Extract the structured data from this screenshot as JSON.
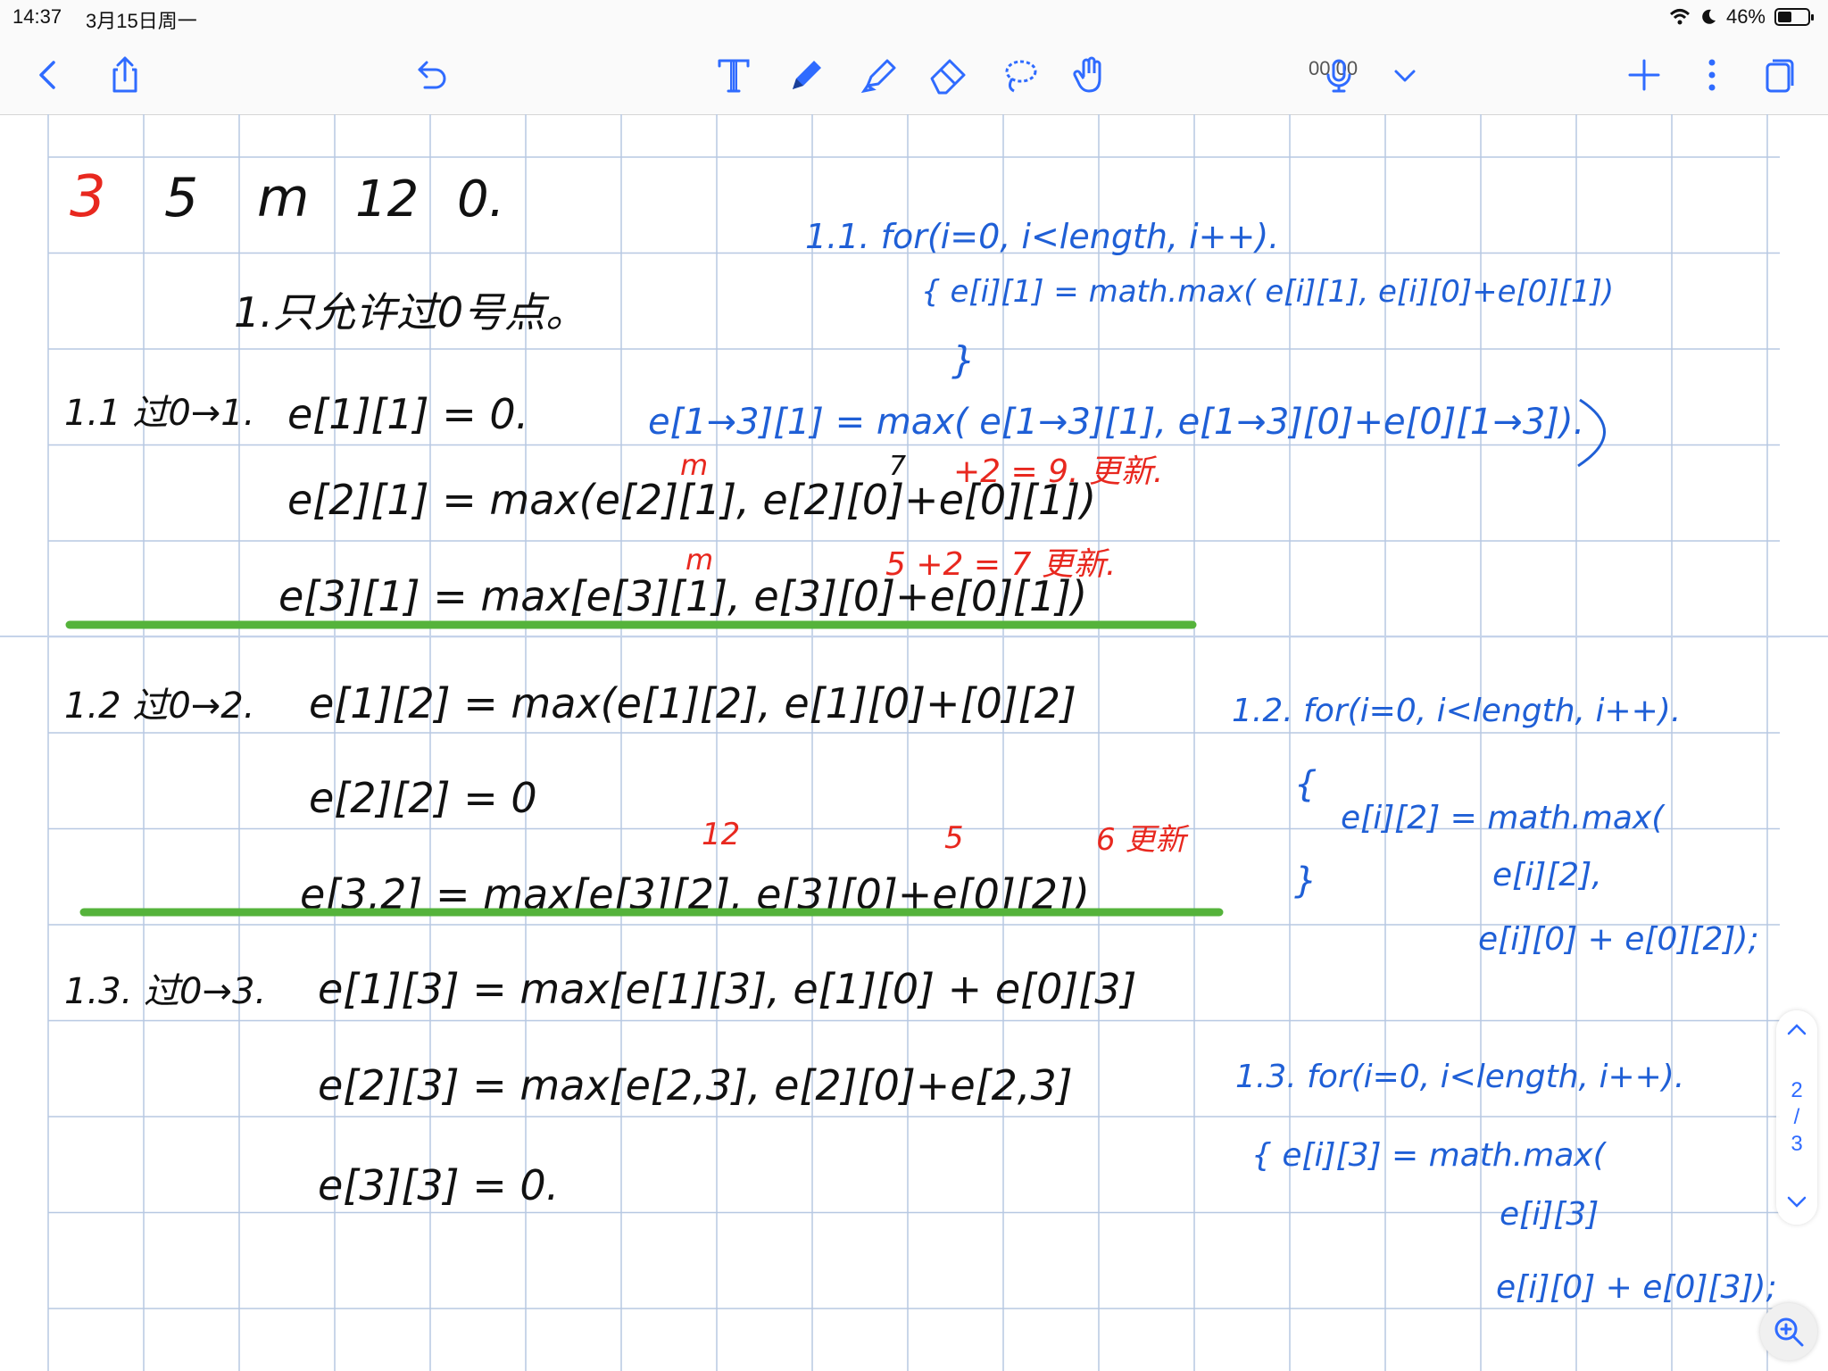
{
  "status_bar": {
    "time": "14:37",
    "date": "3月15日周一",
    "battery": "46%",
    "battery_level": 0.46
  },
  "toolbar": {
    "timer": "00:00"
  },
  "notes": {
    "black": [
      {
        "text": "3",
        "color": "red"
      },
      {
        "text": "5",
        "color": "black"
      },
      {
        "text": "m",
        "color": "black"
      },
      {
        "text": "12",
        "color": "black"
      },
      {
        "text": "0.",
        "color": "black"
      },
      {
        "text": "1.只允许过0号点。",
        "color": "black"
      },
      {
        "text": "1.1 过0→1.",
        "color": "black"
      },
      {
        "text": "e[1][1] = 0.",
        "color": "black"
      },
      {
        "text": "e[2][1] = max(e[2][1], e[2][0]+e[0][1])",
        "color": "black"
      },
      {
        "text": "e[3][1] = max[e[3][1], e[3][0]+e[0][1])",
        "color": "black"
      },
      {
        "text": "1.2 过0→2.",
        "color": "black"
      },
      {
        "text": "e[1][2] = max(e[1][2], e[1][0]+[0][2]",
        "color": "black"
      },
      {
        "text": "e[2][2] = 0",
        "color": "black"
      },
      {
        "text": "e[3,2] = max[e[3][2], e[3][0]+e[0][2])",
        "color": "black"
      },
      {
        "text": "1.3. 过0→3.",
        "color": "black"
      },
      {
        "text": "e[1][3] = max[e[1][3], e[1][0] + e[0][3]",
        "color": "black"
      },
      {
        "text": "e[2][3] = max[e[2,3], e[2][0]+e[2,3]",
        "color": "black"
      },
      {
        "text": "e[3][3] = 0.",
        "color": "black"
      }
    ],
    "red": [
      {
        "text": "m",
        "color": "red"
      },
      {
        "text": "7",
        "color": "red"
      },
      {
        "text": "+2 = 9. 更新.",
        "color": "red"
      },
      {
        "text": "m",
        "color": "red"
      },
      {
        "text": "5 +2 = 7 更新.",
        "color": "red"
      },
      {
        "text": "12",
        "color": "red"
      },
      {
        "text": "5",
        "color": "red"
      },
      {
        "text": "6 更新",
        "color": "red"
      }
    ],
    "blue": [
      {
        "text": "1.1. for(i=0, i<length, i++).",
        "color": "blue"
      },
      {
        "text": "{ e[i][1] = math.max( e[i][1], e[i][0]+e[0][1])",
        "color": "blue"
      },
      {
        "text": "}",
        "color": "blue"
      },
      {
        "text": "e[1→3][1] = max( e[1→3][1], e[1→3][0]+e[0][1→3]).",
        "color": "blue"
      },
      {
        "text": "1.2. for(i=0, i<length, i++).",
        "color": "blue"
      },
      {
        "text": "{",
        "color": "blue"
      },
      {
        "text": "e[i][2] = math.max(",
        "color": "blue"
      },
      {
        "text": "}",
        "color": "blue"
      },
      {
        "text": "e[i][2],",
        "color": "blue"
      },
      {
        "text": "e[i][0] + e[0][2]);",
        "color": "blue"
      },
      {
        "text": "1.3. for(i=0, i<length, i++).",
        "color": "blue"
      },
      {
        "text": "{ e[i][3] = math.max(",
        "color": "blue"
      },
      {
        "text": "e[i][3]",
        "color": "blue"
      },
      {
        "text": "e[i][0] + e[0][3]);",
        "color": "blue"
      }
    ]
  },
  "page_nav": {
    "current": "2",
    "sep": "/",
    "total": "3"
  },
  "colors": {
    "ink_black": "#111111",
    "ink_red": "#e8281f",
    "ink_blue": "#1f5fd6",
    "highlight_green": "#55b33b",
    "grid": "#b7c8e2",
    "accent": "#2f6bff"
  }
}
